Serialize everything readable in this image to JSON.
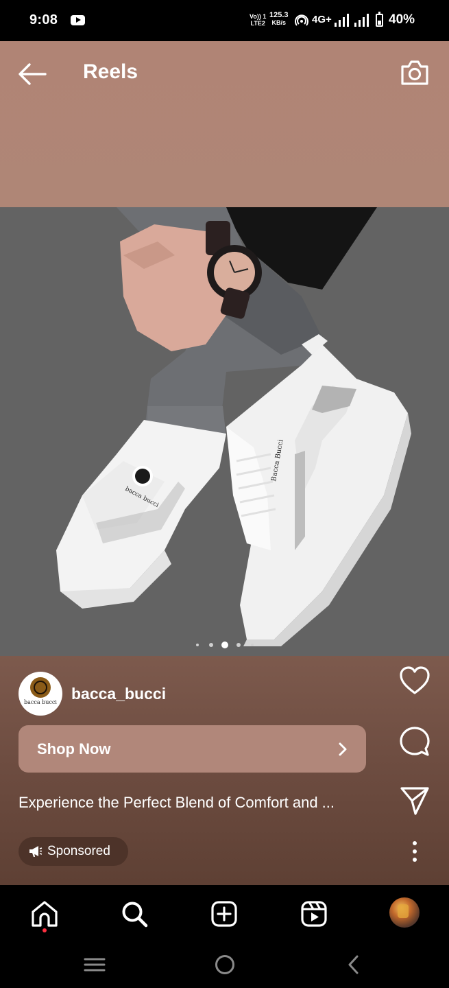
{
  "status_bar": {
    "time": "9:08",
    "volte_line1": "Vo)) 1",
    "volte_line2": "LTE2",
    "speed_value": "125.3",
    "speed_unit": "KB/s",
    "network": "4G+",
    "battery": "40%"
  },
  "header": {
    "title": "Reels",
    "back_icon": "arrow-left-icon",
    "camera_icon": "camera-icon"
  },
  "media": {
    "carousel_count": 5,
    "carousel_active_index": 2
  },
  "post": {
    "username": "bacca_bucci",
    "brand_logo_text": "bacca bucci",
    "cta_label": "Shop Now",
    "caption": "Experience the Perfect Blend of Comfort and ...",
    "sponsored_label": "Sponsored"
  },
  "actions": [
    "heart-icon",
    "comment-icon",
    "share-icon",
    "more-icon"
  ],
  "bottom_nav": [
    "home-icon",
    "search-icon",
    "create-icon",
    "reels-icon",
    "profile-avatar"
  ],
  "system_nav": [
    "recents-icon",
    "home-circle-icon",
    "back-chevron-icon"
  ],
  "colors": {
    "header_bg": "#b08475",
    "info_bg": "#6e4d41",
    "cta_bg": "#b1877a",
    "notification_dot": "#ff3040"
  }
}
